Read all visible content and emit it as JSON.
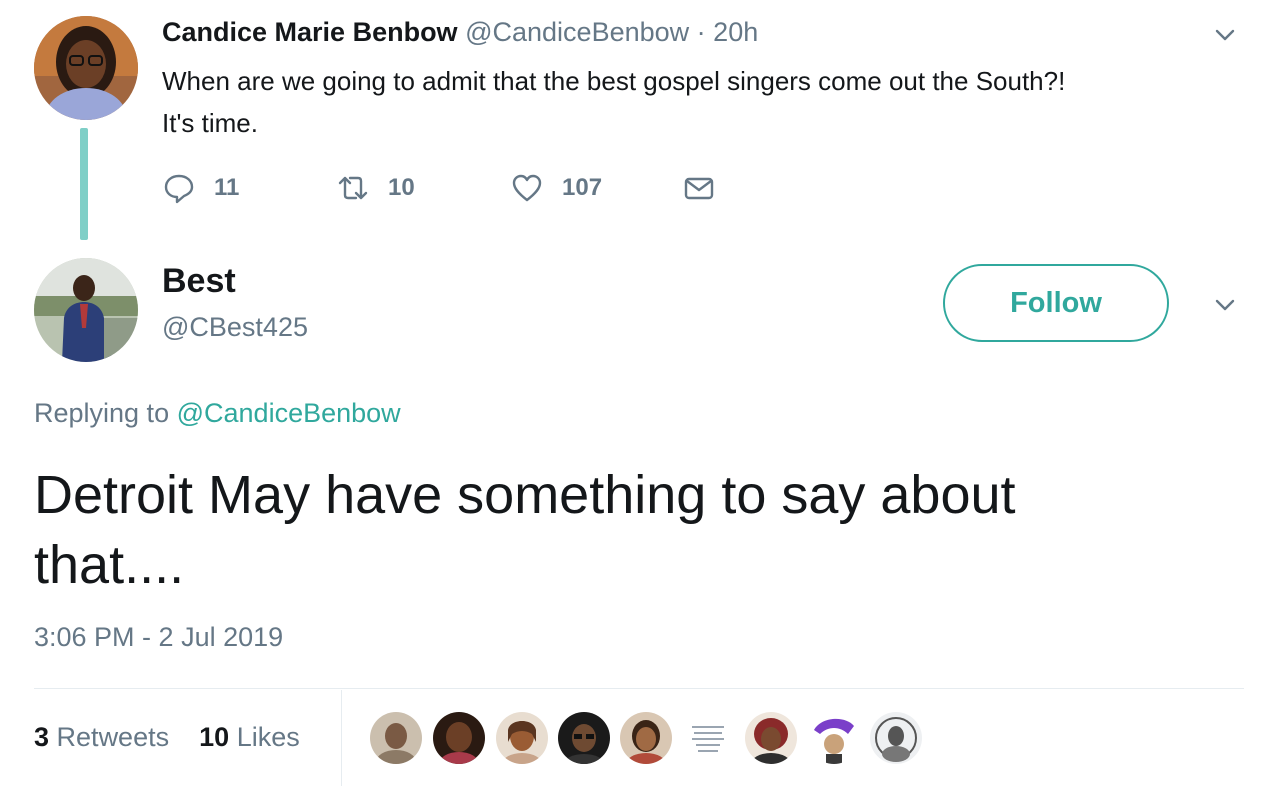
{
  "parent_tweet": {
    "name": "Candice Marie Benbow",
    "handle": "@CandiceBenbow",
    "separator": "·",
    "time": "20h",
    "text_line1": "When are we going to admit that the best gospel singers come out the South?!",
    "text_line2": "It's time.",
    "reply_count": "11",
    "retweet_count": "10",
    "like_count": "107"
  },
  "reply_tweet": {
    "name": "Best",
    "handle": "@CBest425",
    "follow_label": "Follow",
    "replying_prefix": "Replying to",
    "replying_to": "@CandiceBenbow",
    "text_line1": "Detroit May have something to say about",
    "text_line2": "that....",
    "timestamp": "3:06 PM - 2 Jul 2019",
    "retweets_count": "3",
    "retweets_label": "Retweets",
    "likes_count": "10",
    "likes_label": "Likes",
    "liker_avatars": [
      "avatar-1",
      "avatar-2",
      "avatar-3",
      "avatar-4",
      "avatar-5",
      "avatar-6",
      "avatar-7",
      "avatar-8",
      "avatar-9"
    ]
  },
  "icons": {
    "reply": "reply-icon",
    "retweet": "retweet-icon",
    "like": "heart-icon",
    "dm": "envelope-icon",
    "caret": "chevron-down-icon"
  },
  "colors": {
    "accent": "#30a89d",
    "thread_line": "#7fcfc7",
    "secondary_text": "#657786",
    "primary_text": "#14171a"
  }
}
